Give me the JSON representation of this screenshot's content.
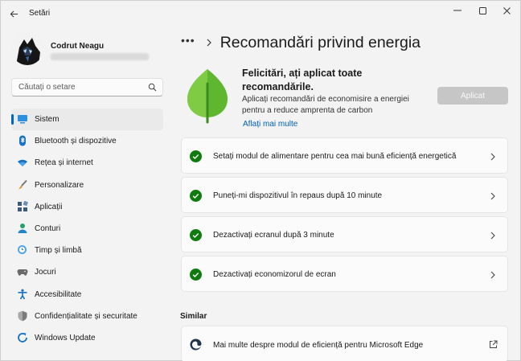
{
  "window": {
    "title": "Setări",
    "controls": [
      "minimize",
      "maximize",
      "close"
    ]
  },
  "profile": {
    "name": "Codrut Neagu"
  },
  "search": {
    "placeholder": "Căutați o setare",
    "icon": "search-icon"
  },
  "sidebar": {
    "items": [
      {
        "label": "Sistem",
        "icon": "monitor-icon",
        "active": true,
        "color": "#0f7ad1"
      },
      {
        "label": "Bluetooth și dispozitive",
        "icon": "bluetooth-icon",
        "active": false,
        "color": "#0f7ad1"
      },
      {
        "label": "Rețea și internet",
        "icon": "wifi-icon",
        "active": false,
        "color": "#0f7ad1"
      },
      {
        "label": "Personalizare",
        "icon": "brush-icon",
        "active": false,
        "color": "#e08a2c"
      },
      {
        "label": "Aplicații",
        "icon": "apps-icon",
        "active": false,
        "color": "#3c5a7a"
      },
      {
        "label": "Conturi",
        "icon": "person-icon",
        "active": false,
        "color": "#22a06b"
      },
      {
        "label": "Timp și limbă",
        "icon": "globe-clock-icon",
        "active": false,
        "color": "#0f7ad1"
      },
      {
        "label": "Jocuri",
        "icon": "gamepad-icon",
        "active": false,
        "color": "#6a6a6a"
      },
      {
        "label": "Accesibilitate",
        "icon": "accessibility-icon",
        "active": false,
        "color": "#1672c5"
      },
      {
        "label": "Confidențialitate și securitate",
        "icon": "shield-icon",
        "active": false,
        "color": "#6e6e6e"
      },
      {
        "label": "Windows Update",
        "icon": "update-icon",
        "active": false,
        "color": "#0f7ad1"
      }
    ]
  },
  "header": {
    "more": "•••",
    "title": "Recomandări privind energia"
  },
  "hero": {
    "title": "Felicitări, ați aplicat toate recomandările.",
    "description": "Aplicați recomandări de economisire a energiei pentru a reduce amprenta de carbon",
    "link": "Aflați mai multe",
    "apply_label": "Aplicat",
    "accent": "#5fb72f"
  },
  "recommendations": [
    {
      "label": "Setați modul de alimentare pentru cea mai bună eficiență energetică",
      "status": "applied"
    },
    {
      "label": "Puneți-mi dispozitivul în repaus după 10 minute",
      "status": "applied"
    },
    {
      "label": "Dezactivați ecranul după 3 minute",
      "status": "applied"
    },
    {
      "label": "Dezactivați economizorul de ecran",
      "status": "applied"
    }
  ],
  "similar": {
    "title": "Similar",
    "items": [
      {
        "label": "Mai multe despre modul de eficiență pentru Microsoft Edge",
        "icon": "edge-icon",
        "trailing_icon": "external-link-icon"
      }
    ]
  },
  "colors": {
    "check": "#0f7b0f",
    "link": "#0060b8",
    "accent": "#0067c0"
  }
}
